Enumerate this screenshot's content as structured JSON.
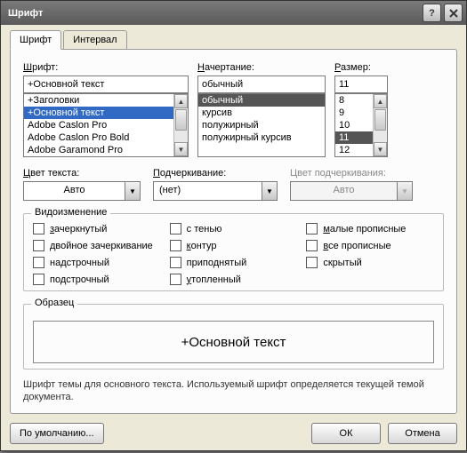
{
  "titlebar": {
    "title": "Шрифт"
  },
  "tabs": {
    "font": "Шрифт",
    "interval": "Интервал"
  },
  "font_section": {
    "label": "Шрифт:",
    "value": "+Основной текст",
    "items": [
      "+Заголовки",
      "+Основной текст",
      "Adobe Caslon Pro",
      "Adobe Caslon Pro Bold",
      "Adobe Garamond Pro"
    ],
    "selected_index": 1
  },
  "style_section": {
    "label": "Начертание:",
    "value": "обычный",
    "items": [
      "обычный",
      "курсив",
      "полужирный",
      "полужирный курсив"
    ],
    "selected_index": 0
  },
  "size_section": {
    "label": "Размер:",
    "value": "11",
    "items": [
      "8",
      "9",
      "10",
      "11",
      "12"
    ],
    "selected_index": 3
  },
  "color_section": {
    "label": "Цвет текста:",
    "value": "Авто"
  },
  "underline_section": {
    "label": "Подчеркивание:",
    "value": "(нет)"
  },
  "ulcolor_section": {
    "label": "Цвет подчеркивания:",
    "value": "Авто"
  },
  "effects": {
    "label": "Видоизменение",
    "col1": [
      "зачеркнутый",
      "двойное зачеркивание",
      "надстрочный",
      "подстрочный"
    ],
    "col2": [
      "с тенью",
      "контур",
      "приподнятый",
      "утопленный"
    ],
    "col3": [
      "малые прописные",
      "все прописные",
      "скрытый"
    ]
  },
  "sample": {
    "label": "Образец",
    "text": "+Основной текст"
  },
  "description": "Шрифт темы для основного текста. Используемый шрифт определяется текущей темой документа.",
  "buttons": {
    "default": "По умолчанию...",
    "ok": "ОК",
    "cancel": "Отмена"
  }
}
